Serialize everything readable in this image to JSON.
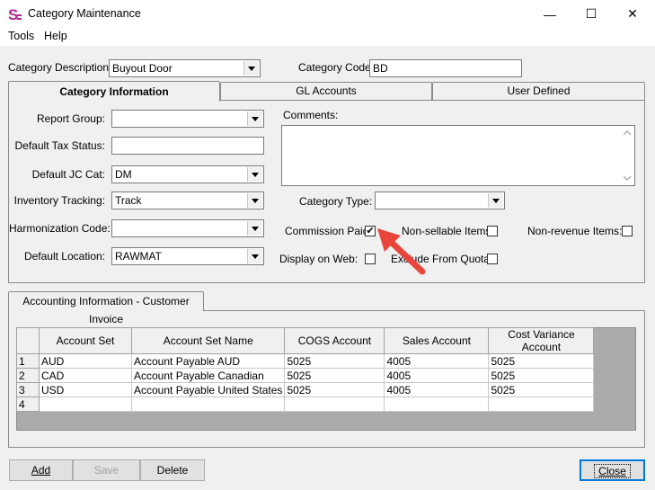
{
  "window": {
    "title": "Category Maintenance",
    "minimize_glyph": "—",
    "maximize_glyph": "☐",
    "close_glyph": "✕"
  },
  "menu": {
    "items": [
      "Tools",
      "Help"
    ]
  },
  "header": {
    "category_description_label": "Category Description:",
    "category_description_value": "Buyout Door",
    "category_code_label": "Category Code:",
    "category_code_value": "BD"
  },
  "tabs": [
    {
      "label": "Category Information",
      "active": true
    },
    {
      "label": "GL Accounts",
      "active": false
    },
    {
      "label": "User Defined",
      "active": false
    }
  ],
  "category_info": {
    "report_group_label": "Report Group:",
    "report_group_value": "",
    "default_tax_status_label": "Default Tax Status:",
    "default_tax_status_value": "",
    "default_jc_cat_label": "Default JC Cat:",
    "default_jc_cat_value": "DM",
    "inventory_tracking_label": "Inventory Tracking:",
    "inventory_tracking_value": "Track",
    "harmonization_code_label": "Harmonization Code:",
    "harmonization_code_value": "",
    "default_location_label": "Default Location:",
    "default_location_value": "RAWMAT",
    "comments_label": "Comments:",
    "comments_value": "",
    "category_type_label": "Category Type:",
    "category_type_value": "",
    "commission_paid_label": "Commission Paid:",
    "commission_paid_checked": true,
    "check_glyph": "✔",
    "non_sellable_label": "Non-sellable Items:",
    "non_sellable_checked": false,
    "non_revenue_label": "Non-revenue Items:",
    "non_revenue_checked": false,
    "display_on_web_label": "Display on Web:",
    "display_on_web_checked": false,
    "exclude_from_quota_label": "Exclude From Quota:",
    "exclude_from_quota_checked": false
  },
  "accounting": {
    "tab_label": "Accounting Information - Customer Invoice",
    "columns": [
      "Account Set",
      "Account Set Name",
      "COGS Account",
      "Sales Account",
      "Cost Variance Account"
    ],
    "rows": [
      {
        "num": "1",
        "cells": [
          "AUD",
          "Account Payable AUD",
          "5025",
          "4005",
          "5025"
        ]
      },
      {
        "num": "2",
        "cells": [
          "CAD",
          "Account Payable Canadian",
          "5025",
          "4005",
          "5025"
        ]
      },
      {
        "num": "3",
        "cells": [
          "USD",
          "Account Payable United States",
          "5025",
          "4005",
          "5025"
        ]
      },
      {
        "num": "4",
        "cells": [
          "",
          "",
          "",
          "",
          ""
        ]
      }
    ]
  },
  "buttons": {
    "add": "Add",
    "save": "Save",
    "delete": "Delete",
    "close": "Close"
  },
  "colors": {
    "annotation_arrow": "#e8453c",
    "app_icon": "#b0278f"
  }
}
